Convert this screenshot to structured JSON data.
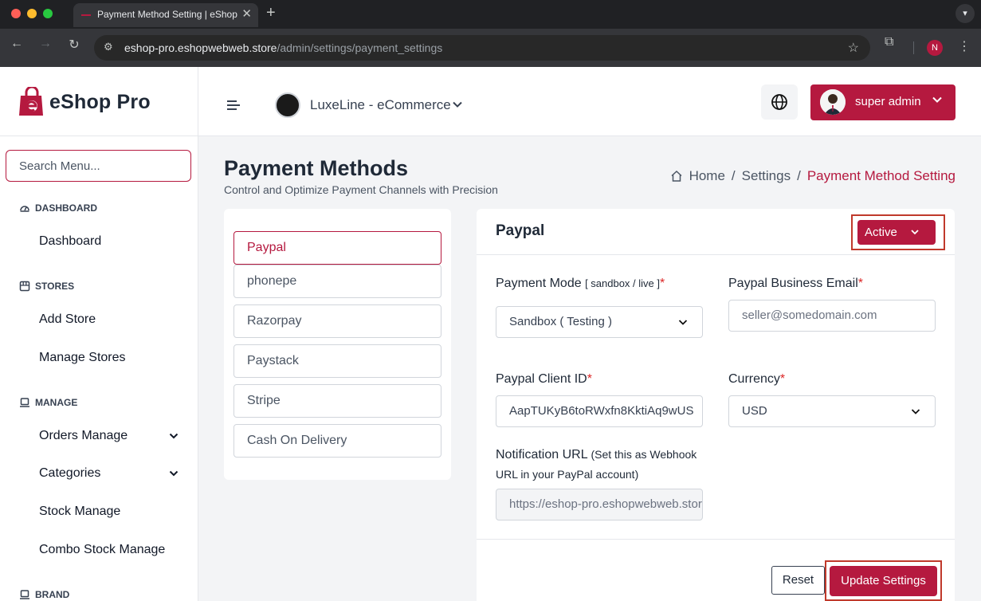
{
  "browser": {
    "tab_title": "Payment Method Setting | eShop",
    "url_host": "eshop-pro.eshopwebweb.store",
    "url_path": "/admin/settings/payment_settings",
    "profile_initial": "N"
  },
  "sidebar": {
    "brand": "eShop Pro",
    "search_placeholder": "Search Menu...",
    "sections": [
      {
        "title": "DASHBOARD",
        "items": [
          "Dashboard"
        ]
      },
      {
        "title": "STORES",
        "items": [
          "Add Store",
          "Manage Stores"
        ]
      },
      {
        "title": "MANAGE",
        "items": [
          "Orders Manage",
          "Categories",
          "Stock Manage",
          "Combo Stock Manage"
        ]
      },
      {
        "title": "BRAND",
        "items": []
      }
    ]
  },
  "header": {
    "store_name": "LuxeLine - eCommerce",
    "user_name": "super admin"
  },
  "page": {
    "title": "Payment Methods",
    "subtitle": "Control and Optimize Payment Channels with Precision",
    "breadcrumb": [
      "Home",
      "Settings",
      "Payment Method Setting"
    ]
  },
  "methods": [
    "Paypal",
    "phonepe",
    "Razorpay",
    "Paystack",
    "Stripe",
    "Cash On Delivery"
  ],
  "form": {
    "title": "Paypal",
    "status": "Active",
    "mode_label": "Payment Mode",
    "mode_hint": "[ sandbox / live ]",
    "mode_value": "Sandbox ( Testing )",
    "email_label": "Paypal Business Email",
    "email_placeholder": "seller@somedomain.com",
    "client_id_label": "Paypal Client ID",
    "client_id_value": "AapTUKyB6toRWxfn8KktiAq9wUS",
    "currency_label": "Currency",
    "currency_value": "USD",
    "notify_label": "Notification URL",
    "notify_hint": "(Set this as Webhook URL in your PayPal account)",
    "notify_value": "https://eshop-pro.eshopwebweb.store/",
    "required_mark": "*",
    "reset_label": "Reset",
    "update_label": "Update Settings"
  },
  "colors": {
    "accent": "#b5193f",
    "highlight_border": "#c0392b"
  }
}
